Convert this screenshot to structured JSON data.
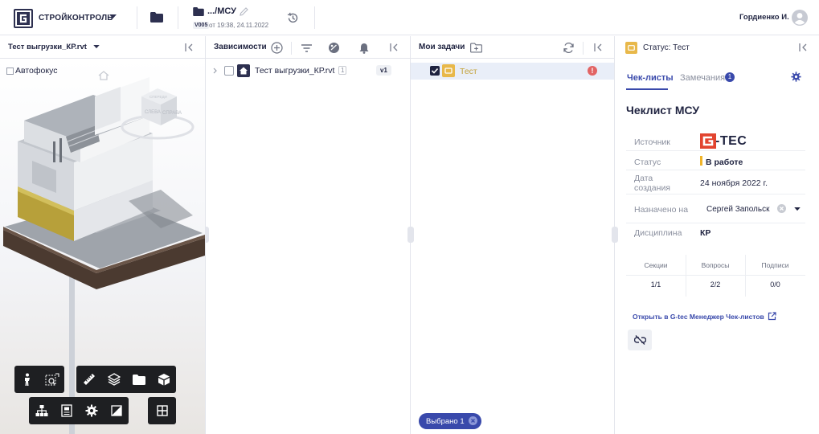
{
  "topbar": {
    "brand": "СТРОЙКОНТРОЛЬ",
    "breadcrumb_path": ".../МСУ",
    "version_badge": "V005",
    "version_date": "от 19:38, 24.11.2022",
    "user_name": "Гордиенко И."
  },
  "viewer": {
    "model_name": "Тест выгрузки_КР.rvt",
    "autofocus_label": "Автофокус",
    "cube_labels": [
      "СПЕРЕДИ",
      "СЛЕВА",
      "СПРАВА"
    ]
  },
  "dependencies": {
    "title": "Зависимости",
    "items": [
      {
        "name": "Тест выгрузки_КР.rvt",
        "count": "1",
        "version": "v1"
      }
    ]
  },
  "tasks": {
    "title": "Мои задачи",
    "items": [
      {
        "name": "Тест",
        "alert": "!"
      }
    ],
    "selected_chip": "Выбрано 1"
  },
  "status_panel": {
    "title": "Статус: Тест",
    "tabs": [
      {
        "label": "Чек-листы",
        "active": true
      },
      {
        "label": "Замечания",
        "badge": "1"
      }
    ],
    "checklist_title": "Чеклист МСУ",
    "fields": {
      "source_label": "Источник",
      "source_logo_text": "G-TEC",
      "status_label": "Статус",
      "status_value": "В работе",
      "created_label": "Дата создания",
      "created_value": "24 ноября 2022 г.",
      "assigned_label": "Назначено на",
      "assigned_value": "Сергей Запольск",
      "discipline_label": "Дисциплина",
      "discipline_value": "КР"
    },
    "stats": {
      "headers": [
        "Секции",
        "Вопросы",
        "Подписи"
      ],
      "values": [
        "1/1",
        "2/2",
        "0/0"
      ]
    },
    "open_link": "Открыть в G-tec Менеджер Чек-листов"
  },
  "colors": {
    "accent": "#3949ab",
    "dark": "#2d3050",
    "status_bar": "#f0b429",
    "alert": "#e26464",
    "folder_yellow": "#e8b84a",
    "logo_red": "#e2442f"
  }
}
